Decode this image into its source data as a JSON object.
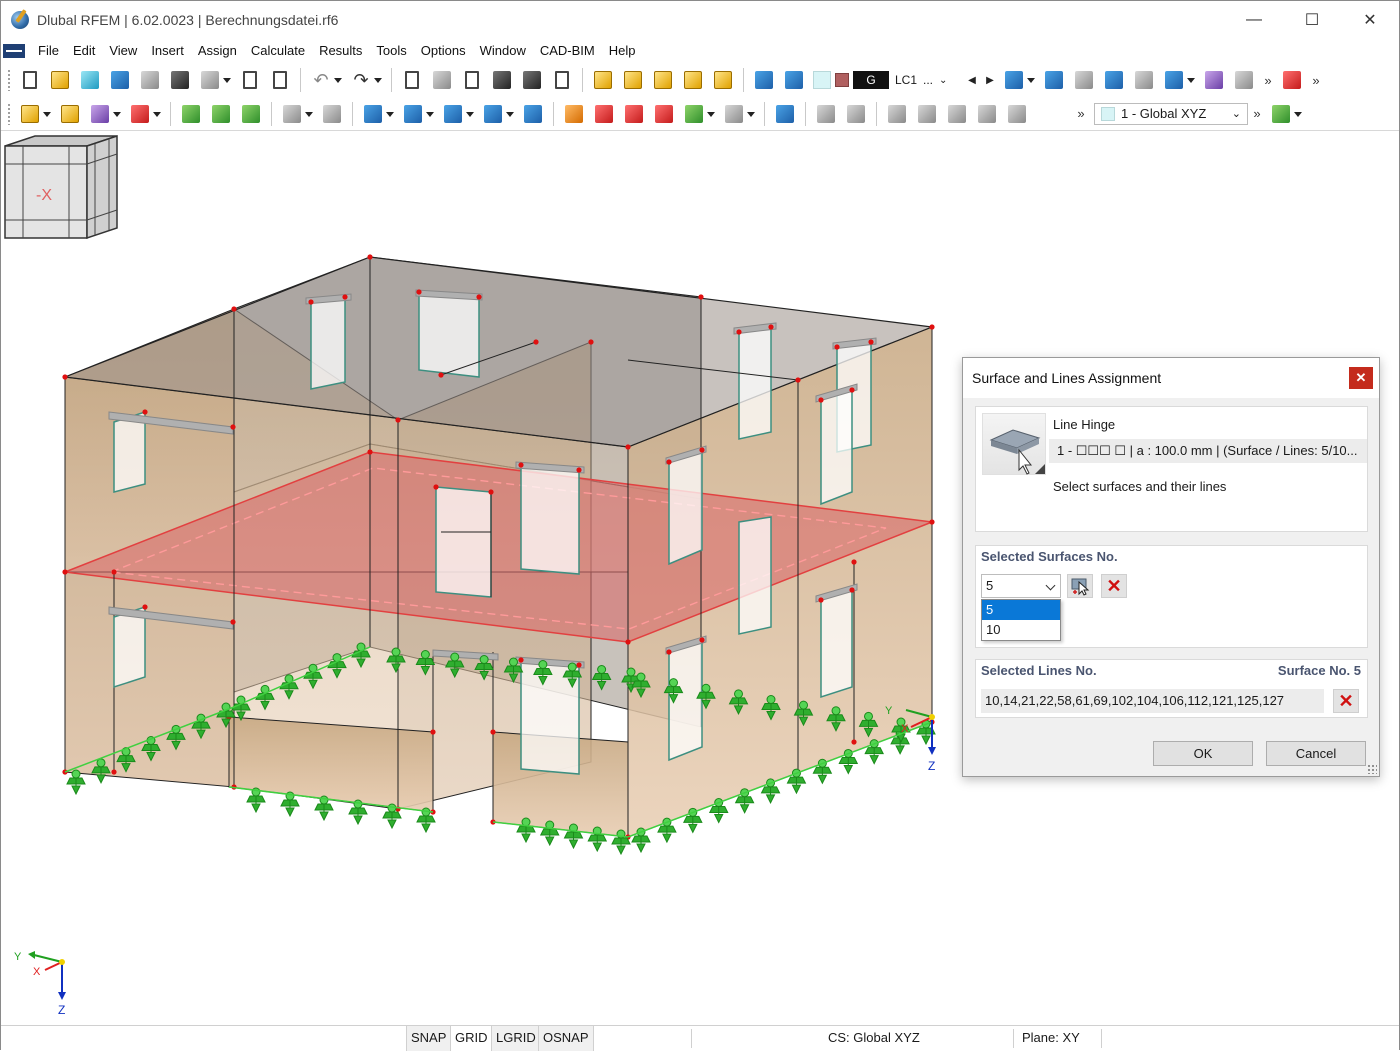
{
  "titlebar": {
    "title": "Dlubal RFEM | 6.02.0023 | Berechnungsdatei.rf6",
    "minimize": "—",
    "maximize": "☐",
    "close": "✕"
  },
  "menu": [
    "File",
    "Edit",
    "View",
    "Insert",
    "Assign",
    "Calculate",
    "Results",
    "Tools",
    "Options",
    "Window",
    "CAD-BIM",
    "Help"
  ],
  "toolbar": {
    "load_case_group": "G",
    "load_case": "LC1",
    "load_case_more": "...",
    "coordinate_system": "1 - Global XYZ",
    "overflow": "»"
  },
  "viewport": {
    "navcube_label": "-X",
    "axis_main": {
      "x": "X",
      "y": "Y",
      "z": "Z"
    },
    "axis_corner": {
      "x": "X",
      "y": "Y",
      "z": "Z"
    }
  },
  "dialog": {
    "title": "Surface and Lines Assignment",
    "close": "✕",
    "hinge_label": "Line Hinge",
    "hinge_value": "1 - ☐☐☐ ☐ | a : 100.0 mm | (Surface / Lines: 5/10...",
    "hinge_hint": "Select surfaces and their lines",
    "surfaces_header": "Selected Surfaces No.",
    "surfaces_selected": "5",
    "surfaces_options": [
      "5",
      "10"
    ],
    "lines_header": "Selected Lines No.",
    "lines_surface": "Surface No. 5",
    "lines_value": "10,14,21,22,58,61,69,102,104,106,112,121,125,127",
    "ok": "OK",
    "cancel": "Cancel",
    "delete_glyph": "✕"
  },
  "statusbar": {
    "snap": "SNAP",
    "grid": "GRID",
    "lgrid": "LGRID",
    "osnap": "OSNAP",
    "cs": "CS: Global XYZ",
    "plane": "Plane: XY"
  }
}
